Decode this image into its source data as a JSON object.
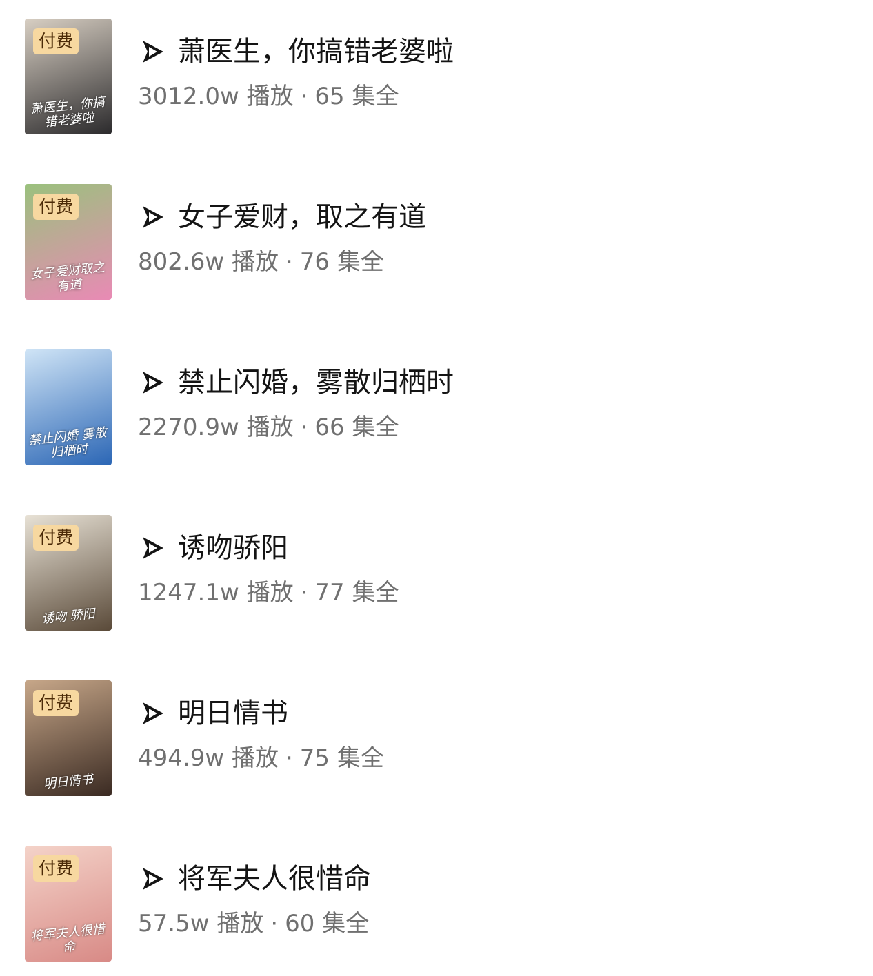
{
  "dramas": [
    {
      "title": "萧医生，你搞错老婆啦",
      "plays": "3012.0w",
      "plays_suffix": "播放",
      "episodes": "65",
      "episodes_suffix": "集全",
      "badge": "付费",
      "poster_text": "萧医生，你搞错老婆啦",
      "colors": {
        "a": "#d8cfc3",
        "b": "#2b2a2c"
      }
    },
    {
      "title": "女子爱财，取之有道",
      "plays": "802.6w",
      "plays_suffix": "播放",
      "episodes": "76",
      "episodes_suffix": "集全",
      "badge": "付费",
      "poster_text": "女子爱财取之有道",
      "colors": {
        "a": "#9ac17d",
        "b": "#e98ab5"
      }
    },
    {
      "title": "禁止闪婚，雾散归栖时",
      "plays": "2270.9w",
      "plays_suffix": "播放",
      "episodes": "66",
      "episodes_suffix": "集全",
      "badge": "",
      "poster_text": "禁止闪婚 雾散归栖时",
      "colors": {
        "a": "#cfe4f6",
        "b": "#2b66b5"
      }
    },
    {
      "title": "诱吻骄阳",
      "plays": "1247.1w",
      "plays_suffix": "播放",
      "episodes": "77",
      "episodes_suffix": "集全",
      "badge": "付费",
      "poster_text": "诱吻 骄阳",
      "colors": {
        "a": "#e8e2d6",
        "b": "#5a4a39"
      }
    },
    {
      "title": "明日情书",
      "plays": "494.9w",
      "plays_suffix": "播放",
      "episodes": "75",
      "episodes_suffix": "集全",
      "badge": "付费",
      "poster_text": "明日情书",
      "colors": {
        "a": "#c7a789",
        "b": "#3a2a22"
      }
    },
    {
      "title": "将军夫人很惜命",
      "plays": "57.5w",
      "plays_suffix": "播放",
      "episodes": "60",
      "episodes_suffix": "集全",
      "badge": "付费",
      "poster_text": "将军夫人很惜命",
      "colors": {
        "a": "#f4d3c9",
        "b": "#d88a86"
      }
    }
  ]
}
